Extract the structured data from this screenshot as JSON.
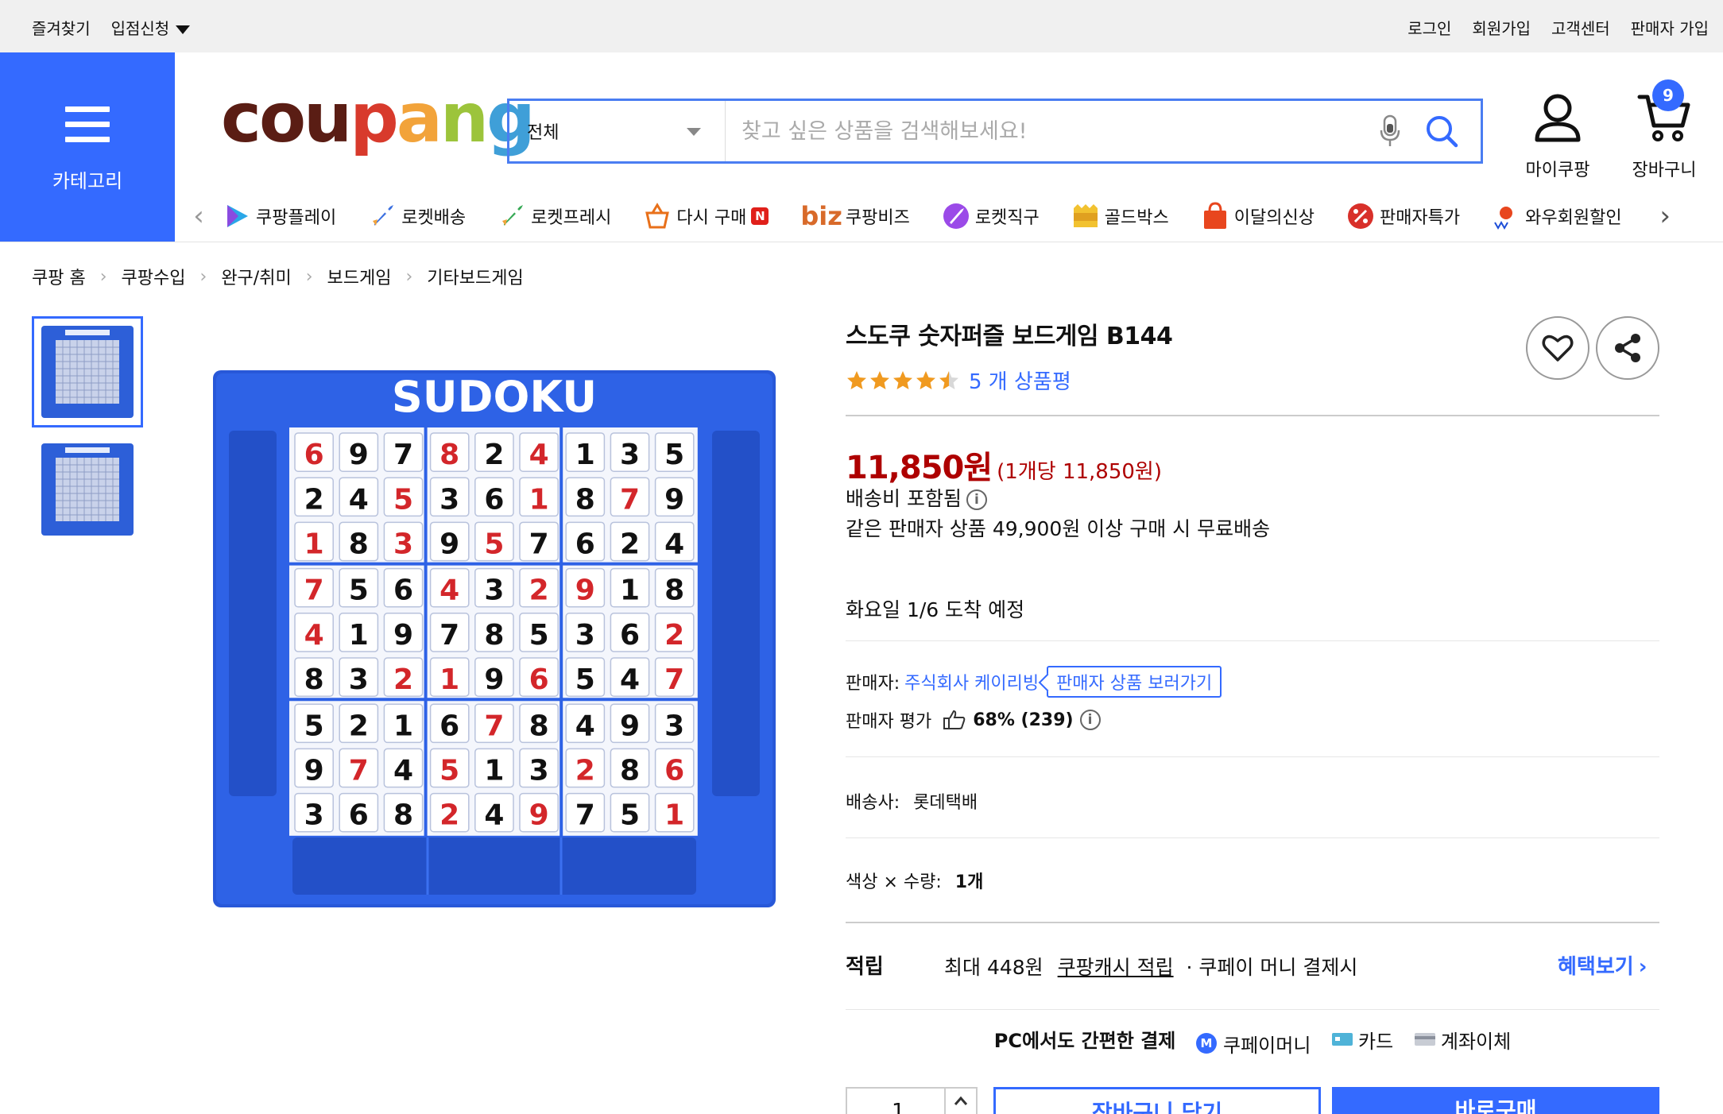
{
  "top_bar": {
    "left": [
      "즐겨찾기",
      "입점신청"
    ],
    "right": [
      "로그인",
      "회원가입",
      "고객센터",
      "판매자 가입"
    ]
  },
  "category_button": {
    "label": "카테고리"
  },
  "logo": {
    "parts": [
      "cou",
      "p",
      "a",
      "n",
      "g"
    ]
  },
  "search": {
    "category": "전체",
    "placeholder": "찾고 싶은 상품을 검색해보세요!",
    "value": ""
  },
  "header_icons": {
    "my_coupang": "마이쿠팡",
    "cart": "장바구니",
    "cart_count": "9"
  },
  "service_nav": [
    {
      "label": "쿠팡플레이",
      "icon": "play-icon"
    },
    {
      "label": "로켓배송",
      "icon": "rocket-icon"
    },
    {
      "label": "로켓프레시",
      "icon": "rocket-fresh-icon"
    },
    {
      "label": "다시 구매",
      "icon": "rebuy-basket-icon",
      "badge": "N"
    },
    {
      "label": "쿠팡비즈",
      "prefix": "biz"
    },
    {
      "label": "로켓직구",
      "icon": "rocket-global-icon"
    },
    {
      "label": "골드박스",
      "icon": "goldbox-icon"
    },
    {
      "label": "이달의신상",
      "icon": "new-bag-icon"
    },
    {
      "label": "판매자특가",
      "icon": "percent-icon"
    },
    {
      "label": "와우회원할인",
      "icon": "wow-icon"
    }
  ],
  "breadcrumb": [
    "쿠팡 홈",
    "쿠팡수입",
    "완구/취미",
    "보드게임",
    "기타보드게임"
  ],
  "product_image": {
    "title": "SUDOKU",
    "grid": [
      [
        6,
        9,
        7,
        8,
        2,
        4,
        1,
        3,
        5
      ],
      [
        2,
        4,
        5,
        3,
        6,
        1,
        8,
        7,
        9
      ],
      [
        1,
        8,
        3,
        9,
        5,
        7,
        6,
        2,
        4
      ],
      [
        7,
        5,
        6,
        4,
        3,
        2,
        9,
        1,
        8
      ],
      [
        4,
        1,
        9,
        7,
        8,
        5,
        3,
        6,
        2
      ],
      [
        8,
        3,
        2,
        1,
        9,
        6,
        5,
        4,
        7
      ],
      [
        5,
        2,
        1,
        6,
        7,
        8,
        4,
        9,
        3
      ],
      [
        9,
        7,
        4,
        5,
        1,
        3,
        2,
        8,
        6
      ],
      [
        3,
        6,
        8,
        2,
        4,
        9,
        7,
        5,
        1
      ]
    ],
    "red_cells": [
      [
        0,
        0
      ],
      [
        0,
        3
      ],
      [
        0,
        5
      ],
      [
        1,
        2
      ],
      [
        1,
        5
      ],
      [
        1,
        7
      ],
      [
        2,
        0
      ],
      [
        2,
        2
      ],
      [
        2,
        4
      ],
      [
        3,
        0
      ],
      [
        3,
        3
      ],
      [
        3,
        5
      ],
      [
        3,
        6
      ],
      [
        4,
        0
      ],
      [
        4,
        8
      ],
      [
        5,
        2
      ],
      [
        5,
        3
      ],
      [
        5,
        5
      ],
      [
        5,
        8
      ],
      [
        6,
        4
      ],
      [
        7,
        1
      ],
      [
        7,
        3
      ],
      [
        7,
        6
      ],
      [
        7,
        8
      ],
      [
        8,
        3
      ],
      [
        8,
        5
      ],
      [
        8,
        8
      ]
    ]
  },
  "product": {
    "title": "스도쿠 숫자퍼즐 보드게임 B144",
    "rating": 4.5,
    "review_count_text": "5 개 상품평",
    "price": "11,850원",
    "unit_price": "(1개당 11,850원)",
    "shipping_fee": "배송비 포함됨",
    "free_shipping_note": "같은 판매자 상품 49,900원 이상 구매 시 무료배송",
    "delivery_date": "화요일 1/6 도착 예정",
    "seller_label": "판매자:",
    "seller_name": "주식회사 케이리빙",
    "seller_products_link": "판매자 상품 보러가기",
    "seller_rating_label": "판매자 평가",
    "seller_rating_value": "68% (239)",
    "courier_label": "배송사:",
    "courier": "롯데택배",
    "option_label": "색상 × 수량:",
    "option_value": "1개",
    "reward_label": "적립",
    "reward_amount": "최대 448원",
    "reward_link": "쿠팡캐시 적립",
    "reward_condition": "· 쿠페이 머니 결제시",
    "benefit_link": "혜택보기",
    "pay_title": "PC에서도 간편한 결제",
    "pay_methods": [
      "쿠페이머니",
      "카드",
      "계좌이체"
    ],
    "quantity": "1",
    "add_to_cart": "장바구니 담기",
    "buy_now": "바로구매"
  },
  "colors": {
    "brand_blue": "#346aff",
    "price_red": "#ae0000",
    "top_bar_bg": "#f0f0f0"
  }
}
